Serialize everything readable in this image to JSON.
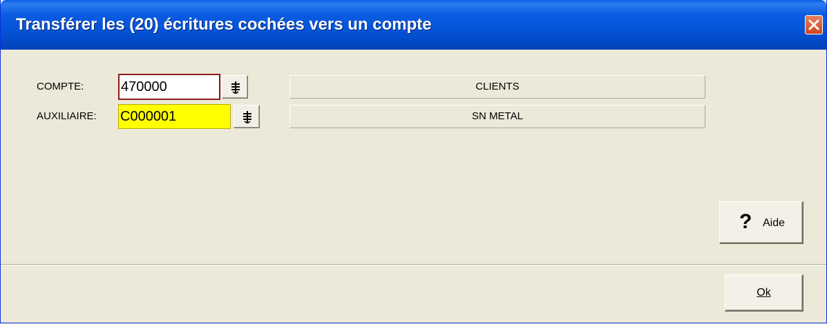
{
  "window": {
    "title": "Transférer les (20) écritures cochées vers un compte"
  },
  "compte": {
    "label": "COMPTE:",
    "value": "470000",
    "name": "CLIENTS",
    "lookup_icon": "list-lookup-icon"
  },
  "auxiliaire": {
    "label": "AUXILIAIRE:",
    "value": "C000001",
    "name": "SN METAL",
    "lookup_icon": "list-lookup-icon"
  },
  "buttons": {
    "aide_icon": "?",
    "aide_label": "Aide",
    "ok_label": "Ok"
  },
  "colors": {
    "title_bar": "#0554d8",
    "dialog_bg": "#ece9d8",
    "aux_field_bg": "#ffff00",
    "compte_border": "#8b1a1a",
    "close_button": "#d2431f"
  }
}
